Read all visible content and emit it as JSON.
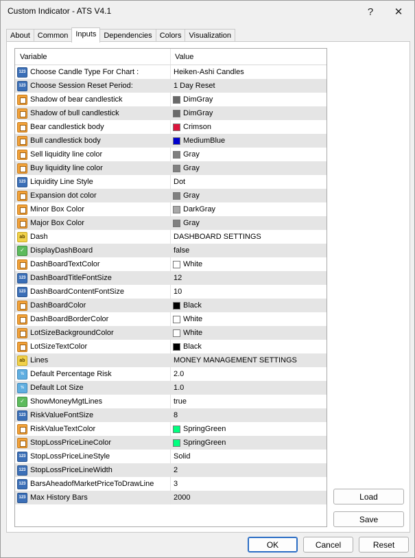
{
  "window": {
    "title": "Custom Indicator - ATS V4.1",
    "help_glyph": "?",
    "close_glyph": "✕"
  },
  "tabs": [
    "About",
    "Common",
    "Inputs",
    "Dependencies",
    "Colors",
    "Visualization"
  ],
  "active_tab": "Inputs",
  "grid": {
    "headers": {
      "variable": "Variable",
      "value": "Value"
    },
    "rows": [
      {
        "variable": "Choose Candle Type For Chart :",
        "value": "Heiken-Ashi Candles",
        "type": "int",
        "icon_text": "123"
      },
      {
        "variable": "Choose Session Reset Period:",
        "value": "1 Day Reset",
        "type": "int",
        "icon_text": "123"
      },
      {
        "variable": "Shadow of bear candlestick",
        "value": "DimGray",
        "type": "color",
        "swatch": "#696969"
      },
      {
        "variable": "Shadow of bull candlestick",
        "value": "DimGray",
        "type": "color",
        "swatch": "#696969"
      },
      {
        "variable": "Bear candlestick body",
        "value": "Crimson",
        "type": "color",
        "swatch": "#dc143c"
      },
      {
        "variable": "Bull candlestick body",
        "value": "MediumBlue",
        "type": "color",
        "swatch": "#0000cd"
      },
      {
        "variable": "Sell liquidity line color",
        "value": "Gray",
        "type": "color",
        "swatch": "#808080"
      },
      {
        "variable": "Buy liquidity line color",
        "value": "Gray",
        "type": "color",
        "swatch": "#808080"
      },
      {
        "variable": "Liquidity Line Style",
        "value": "Dot",
        "type": "int",
        "icon_text": "123"
      },
      {
        "variable": "Expansion dot color",
        "value": "Gray",
        "type": "color",
        "swatch": "#808080"
      },
      {
        "variable": "Minor Box Color",
        "value": "DarkGray",
        "type": "color",
        "swatch": "#a9a9a9"
      },
      {
        "variable": "Major Box Color",
        "value": "Gray",
        "type": "color",
        "swatch": "#808080"
      },
      {
        "variable": "Dash",
        "value": "DASHBOARD SETTINGS",
        "type": "string",
        "icon_text": "ab"
      },
      {
        "variable": "DisplayDashBoard",
        "value": "false",
        "type": "bool",
        "icon_text": "✓"
      },
      {
        "variable": "DashBoardTextColor",
        "value": "White",
        "type": "color",
        "swatch": "#ffffff"
      },
      {
        "variable": "DashBoardTitleFontSize",
        "value": "12",
        "type": "int",
        "icon_text": "123"
      },
      {
        "variable": "DashBoardContentFontSize",
        "value": "10",
        "type": "int",
        "icon_text": "123"
      },
      {
        "variable": "DashBoardColor",
        "value": "Black",
        "type": "color",
        "swatch": "#000000"
      },
      {
        "variable": "DashBoardBorderColor",
        "value": "White",
        "type": "color",
        "swatch": "#ffffff"
      },
      {
        "variable": "LotSizeBackgroundColor",
        "value": "White",
        "type": "color",
        "swatch": "#ffffff"
      },
      {
        "variable": "LotSizeTextColor",
        "value": "Black",
        "type": "color",
        "swatch": "#000000"
      },
      {
        "variable": "Lines",
        "value": "MONEY MANAGEMENT SETTINGS",
        "type": "string",
        "icon_text": "ab"
      },
      {
        "variable": "Default Percentage Risk",
        "value": "2.0",
        "type": "double",
        "icon_text": "½"
      },
      {
        "variable": "Default Lot Size",
        "value": "1.0",
        "type": "double",
        "icon_text": "½"
      },
      {
        "variable": "ShowMoneyMgtLines",
        "value": "true",
        "type": "bool",
        "icon_text": "✓"
      },
      {
        "variable": "RiskValueFontSize",
        "value": "8",
        "type": "int",
        "icon_text": "123"
      },
      {
        "variable": "RiskValueTextColor",
        "value": "SpringGreen",
        "type": "color",
        "swatch": "#00ff7f"
      },
      {
        "variable": "StopLossPriceLineColor",
        "value": "SpringGreen",
        "type": "color",
        "swatch": "#00ff7f"
      },
      {
        "variable": "StopLossPriceLineStyle",
        "value": "Solid",
        "type": "int",
        "icon_text": "123"
      },
      {
        "variable": "StopLossPriceLineWidth",
        "value": "2",
        "type": "int",
        "icon_text": "123"
      },
      {
        "variable": "BarsAheadofMarketPriceToDrawLine",
        "value": "3",
        "type": "int",
        "icon_text": "123"
      },
      {
        "variable": "Max History Bars",
        "value": "2000",
        "type": "int",
        "icon_text": "123"
      }
    ]
  },
  "side_buttons": {
    "load": "Load",
    "save": "Save"
  },
  "footer_buttons": {
    "ok": "OK",
    "cancel": "Cancel",
    "reset": "Reset"
  }
}
